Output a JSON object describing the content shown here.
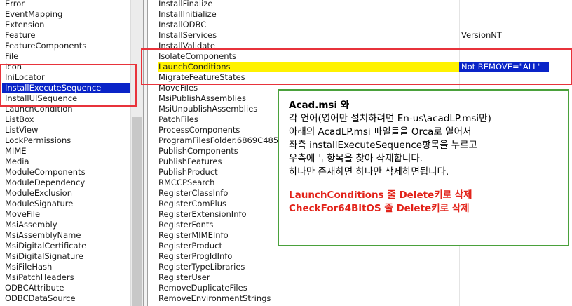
{
  "tables_list": {
    "items": [
      "Error",
      "EventMapping",
      "Extension",
      "Feature",
      "FeatureComponents",
      "File",
      "Icon",
      "IniLocator",
      "InstallExecuteSequence",
      "InstallUISequence",
      "LaunchCondition",
      "ListBox",
      "ListView",
      "LockPermissions",
      "MIME",
      "Media",
      "ModuleComponents",
      "ModuleDependency",
      "ModuleExclusion",
      "ModuleSignature",
      "MoveFile",
      "MsiAssembly",
      "MsiAssemblyName",
      "MsiDigitalCertificate",
      "MsiDigitalSignature",
      "MsiFileHash",
      "MsiPatchHeaders",
      "ODBCAttribute",
      "ODBCDataSource"
    ],
    "selected": "InstallExecuteSequence"
  },
  "sequence_rows": [
    {
      "action": "InstallFinalize",
      "condition": ""
    },
    {
      "action": "InstallInitialize",
      "condition": ""
    },
    {
      "action": "InstallODBC",
      "condition": ""
    },
    {
      "action": "InstallServices",
      "condition": "VersionNT"
    },
    {
      "action": "InstallValidate",
      "condition": ""
    },
    {
      "action": "IsolateComponents",
      "condition": ""
    },
    {
      "action": "LaunchConditions",
      "condition": "Not REMOVE=\"ALL\""
    },
    {
      "action": "MigrateFeatureStates",
      "condition": ""
    },
    {
      "action": "MoveFiles",
      "condition": ""
    },
    {
      "action": "MsiPublishAssemblies",
      "condition": ""
    },
    {
      "action": "MsiUnpublishAssemblies",
      "condition": ""
    },
    {
      "action": "PatchFiles",
      "condition": ""
    },
    {
      "action": "ProcessComponents",
      "condition": ""
    },
    {
      "action": "ProgramFilesFolder.6869C485_",
      "condition": ""
    },
    {
      "action": "PublishComponents",
      "condition": ""
    },
    {
      "action": "PublishFeatures",
      "condition": ""
    },
    {
      "action": "PublishProduct",
      "condition": ""
    },
    {
      "action": "RMCCPSearch",
      "condition": ""
    },
    {
      "action": "RegisterClassInfo",
      "condition": ""
    },
    {
      "action": "RegisterComPlus",
      "condition": ""
    },
    {
      "action": "RegisterExtensionInfo",
      "condition": ""
    },
    {
      "action": "RegisterFonts",
      "condition": ""
    },
    {
      "action": "RegisterMIMEInfo",
      "condition": ""
    },
    {
      "action": "RegisterProduct",
      "condition": ""
    },
    {
      "action": "RegisterProgIdInfo",
      "condition": ""
    },
    {
      "action": "RegisterTypeLibraries",
      "condition": ""
    },
    {
      "action": "RegisterUser",
      "condition": ""
    },
    {
      "action": "RemoveDuplicateFiles",
      "condition": ""
    },
    {
      "action": "RemoveEnvironmentStrings",
      "condition": ""
    }
  ],
  "highlighted_action": "LaunchConditions",
  "note": {
    "lines": [
      "Acad.msi 와",
      "각 언어(영어만 설치하려면 En-us\\acadLP.msi만)",
      "아래의 AcadLP.msi 파일들을 Orca로 열어서",
      "좌측 installExecuteSequence항목을 누르고",
      "우측에 두항목을 찾아 삭제합니다.",
      "하나만 존재하면 하나만 삭제하면됩니다."
    ],
    "red_lines": [
      "LaunchConditions 줄 Delete키로 삭제",
      "CheckFor64BitOS 줄  Delete키로 삭제"
    ]
  },
  "colors": {
    "selection_blue": "#0a24c8",
    "highlight_yellow": "#fff200",
    "annotation_red": "#e8333b",
    "note_border_green": "#4aa13b"
  }
}
